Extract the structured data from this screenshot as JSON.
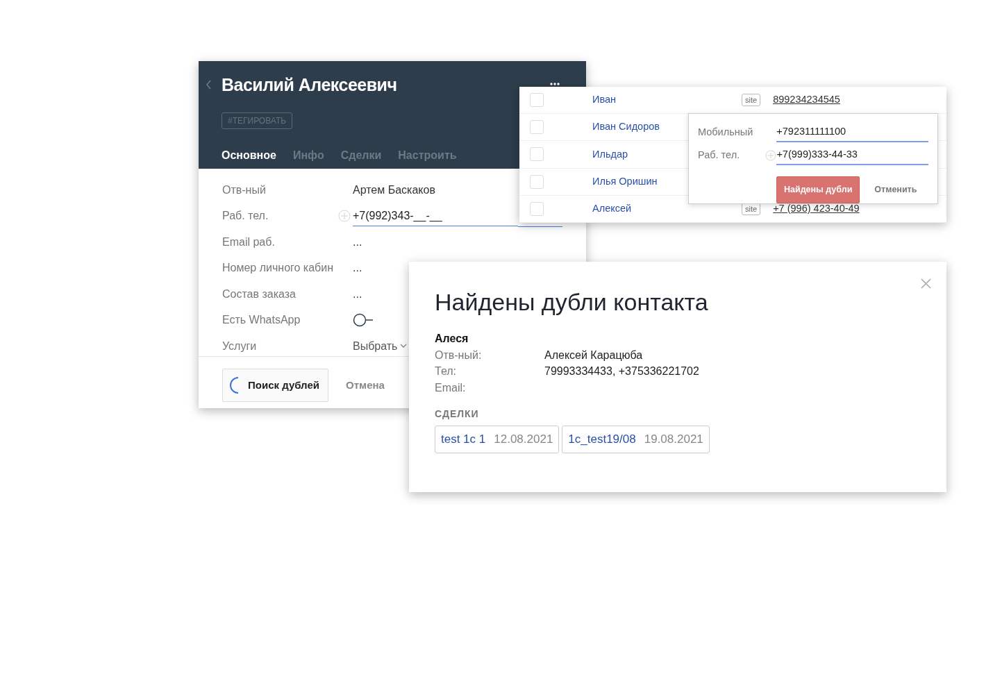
{
  "contact_card": {
    "title": "Василий Алексеевич",
    "tag_button": "#ТЕГИРОВАТЬ",
    "tabs": [
      {
        "label": "Основное",
        "selected": true
      },
      {
        "label": "Инфо",
        "selected": false
      },
      {
        "label": "Сделки",
        "selected": false
      },
      {
        "label": "Настроить",
        "selected": false
      }
    ],
    "fields": [
      {
        "kind": "text",
        "label": "Отв-ный",
        "value": "Артем Баскаков"
      },
      {
        "kind": "phone",
        "label": "Раб. тел.",
        "value": "+7(992)343-__-__"
      },
      {
        "kind": "text",
        "label": "Email раб.",
        "value": "..."
      },
      {
        "kind": "text",
        "label": "Номер личного кабин",
        "value": "..."
      },
      {
        "kind": "text",
        "label": "Состав заказа",
        "value": "..."
      },
      {
        "kind": "toggle",
        "label": "Есть WhatsApp",
        "on": false
      },
      {
        "kind": "select",
        "label": "Услуги",
        "value": "Выбрать"
      }
    ],
    "search_button": {
      "label": "Поиск дублей",
      "loading": true
    },
    "cancel_button": "Отмена"
  },
  "contact_list": {
    "rows": [
      {
        "checked": false,
        "name": "Иван",
        "source": "site",
        "phone": "899234234545"
      },
      {
        "checked": false,
        "name": "Иван Сидоров"
      },
      {
        "checked": false,
        "name": "Ильдар"
      },
      {
        "checked": false,
        "name": "Илья Оришин"
      },
      {
        "checked": false,
        "name": "Алексей",
        "source": "site",
        "phone": "+7 (996) 423-40-49"
      }
    ]
  },
  "duplicate_check_popup": {
    "fields": [
      {
        "kind": "text",
        "label": "Мобильный",
        "value": "+792311111100"
      },
      {
        "kind": "phone",
        "label": "Раб. тел.",
        "value": "+7(999)333-44-33"
      }
    ],
    "confirm_button": "Найдены дубли",
    "cancel_button": "Отменить"
  },
  "duplicates_dialog": {
    "title": "Найдены дубли контакта",
    "contact_name": "Алеся",
    "details": [
      {
        "label": "Отв-ный:",
        "value": "Алексей Карацюба"
      },
      {
        "label": "Тел:",
        "value": "79993334433, +375336221702"
      },
      {
        "label": "Email:"
      }
    ],
    "deals_heading": "СДЕЛКИ",
    "deals": [
      {
        "name": "test 1c 1",
        "date": "12.08.2021"
      },
      {
        "name": "1c_test19/08",
        "date": "19.08.2021"
      }
    ]
  }
}
